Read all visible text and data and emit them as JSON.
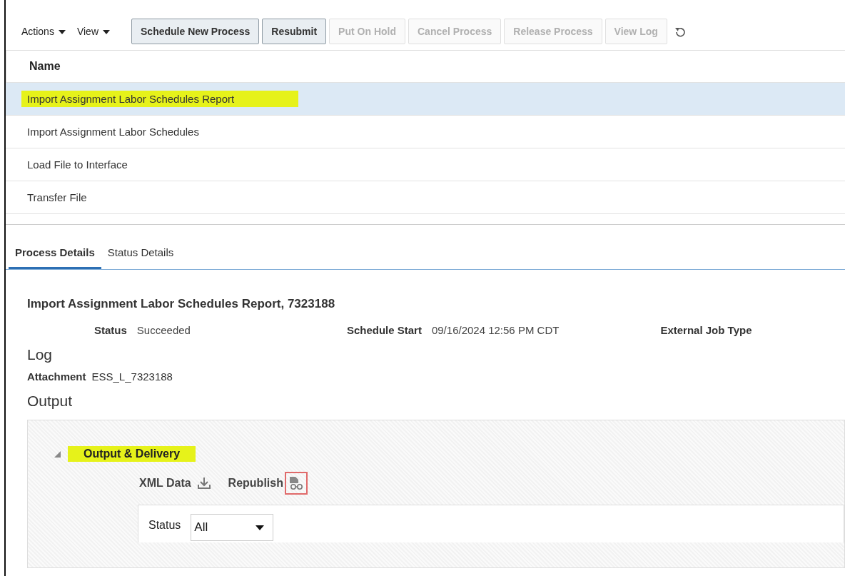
{
  "toolbar": {
    "menus": [
      {
        "label": "Actions"
      },
      {
        "label": "View"
      }
    ],
    "buttons": [
      {
        "label": "Schedule New Process",
        "disabled": false
      },
      {
        "label": "Resubmit",
        "disabled": false
      },
      {
        "label": "Put On Hold",
        "disabled": true
      },
      {
        "label": "Cancel Process",
        "disabled": true
      },
      {
        "label": "Release Process",
        "disabled": true
      },
      {
        "label": "View Log",
        "disabled": true
      }
    ]
  },
  "table": {
    "columns": [
      "Name"
    ],
    "rows": [
      {
        "name": "Import Assignment Labor Schedules Report",
        "selected": true,
        "highlighted": true
      },
      {
        "name": "Import Assignment Labor Schedules",
        "selected": false,
        "highlighted": false
      },
      {
        "name": "Load File to Interface",
        "selected": false,
        "highlighted": false
      },
      {
        "name": "Transfer File",
        "selected": false,
        "highlighted": false
      }
    ]
  },
  "tabs": [
    {
      "label": "Process Details",
      "selected": true
    },
    {
      "label": "Status Details",
      "selected": false
    }
  ],
  "details": {
    "title": "Import Assignment Labor Schedules Report, 7323188",
    "fields": [
      {
        "label": "Status",
        "value": "Succeeded"
      },
      {
        "label": "Schedule Start",
        "value": "09/16/2024 12:56 PM CDT"
      },
      {
        "label": "External Job Type"
      }
    ],
    "log_heading": "Log",
    "attachment_label": "Attachment",
    "attachment_value": "ESS_L_7323188",
    "output_heading": "Output"
  },
  "output": {
    "section": {
      "title": "Output & Delivery",
      "expanded": true,
      "highlighted": true
    },
    "xml_label": "XML Data",
    "republish_label": "Republish",
    "republish_outlined": true,
    "filter": {
      "label": "Status",
      "value": "All"
    }
  }
}
